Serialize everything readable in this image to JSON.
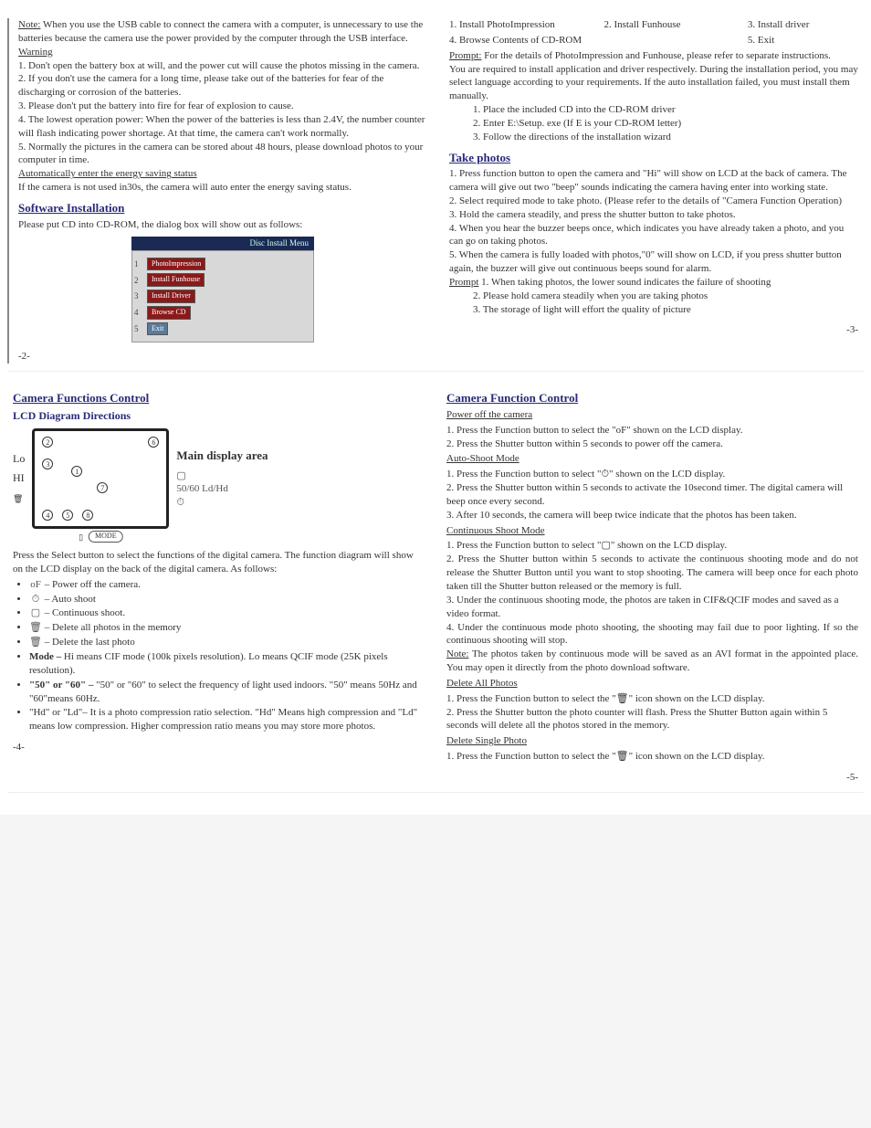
{
  "p2": {
    "note_label": "Note:",
    "note_text": "When you use the USB cable to connect the camera with a computer, is unnecessary to use the batteries because the camera use the power provided by the computer through the USB interface.",
    "warning_label": "Warning",
    "w1": "1.   Don't open the battery box at will, and the power cut will cause the photos missing in the camera.",
    "w2": "2.   If you don't use the camera for a long time, please take out of the batteries for fear of the discharging or corrosion of the batteries.",
    "w3": "3.   Please don't put the battery into fire for fear of explosion to cause.",
    "w4": "4.   The lowest operation power: When the power of the batteries is less than 2.4V, the number counter will flash indicating power shortage. At that time, the camera can't work normally.",
    "w5": "5.   Normally the pictures in the camera can be stored about 48 hours, please download photos to your computer in time.",
    "auto_label": "Automatically enter the energy saving status",
    "auto_text": "If the camera is not used in30s, the camera will auto enter the energy saving status.",
    "soft_heading": "Software Installation",
    "soft_text": "Please put CD into CD-ROM, the dialog box will show out as follows:",
    "dialog_title": "Disc Install Menu",
    "pagenum": "-2-"
  },
  "p3": {
    "opt1": "1. Install PhotoImpression",
    "opt2": "2. Install Funhouse",
    "opt3": "3. Install driver",
    "opt4": "4. Browse Contents of CD-ROM",
    "opt5": "5. Exit",
    "prompt_label": "Prompt:",
    "prompt_text": "For the details of PhotoImpression and Funhouse, please refer to separate instructions.",
    "para": "You are required to install application and driver respectively. During the installation period, you may select language according to your requirements. If the auto installation failed, you must install them manually.",
    "m1": "1.   Place the included CD into the CD-ROM driver",
    "m2": "2.   Enter E:\\Setup. exe (If E is your CD-ROM letter)",
    "m3": "3.   Follow the directions of the installation wizard",
    "take_heading": "Take photos",
    "t1": "1.   Press function button to open the camera and \"Hi\" will show on LCD at the back of camera. The camera will give out two \"beep\" sounds indicating the camera having enter into working state.",
    "t2": "2.   Select required mode to take photo. (Please refer to the details of \"Camera Function Operation)",
    "t3": "3.   Hold the camera steadily, and press the shutter button to take photos.",
    "t4": "4.   When you hear the buzzer beeps once, which indicates you have already taken a photo, and you can go on taking photos.",
    "t5": "5.   When the camera is fully loaded with photos,\"0\" will show on LCD, if you press shutter button again, the buzzer will give out continuous beeps sound for alarm.",
    "pr_label": "Prompt",
    "pr1": "1.   When taking photos, the lower sound indicates the failure of shooting",
    "pr2": "2.   Please hold camera steadily when you are taking photos",
    "pr3": "3.   The storage of light will effort the quality of picture",
    "pagenum": "-3-"
  },
  "p4": {
    "heading": "Camera Functions Control",
    "sub": "LCD Diagram Directions",
    "main_display": "Main display area",
    "lcd_text": "50/60  Ld/Hd",
    "lo": "Lo",
    "hi": "HI",
    "mode": "MODE",
    "intro": "Press the Select button to select the functions of the digital camera. The function diagram will show on the LCD display on the back of the digital camera. As follows:",
    "b1": "– Power off the camera.",
    "b2": "– Auto shoot",
    "b3": "– Continuous shoot.",
    "b4": "– Delete all photos in the memory",
    "b5": "– Delete the last photo",
    "b6_label": "Mode –",
    "b6": "Hi means CIF mode (100k pixels resolution). Lo means QCIF mode (25K pixels resolution).",
    "b7_label": "\"50\" or \"60\" –",
    "b7": "\"50\" or \"60\" to select the frequency of light used indoors. \"50\" means 50Hz and \"60\"means 60Hz.",
    "b8": "\"Hd\" or \"Ld\"– It is a photo compression ratio selection.   \"Hd\" Means high compression and \"Ld\" means low compression. Higher compression ratio means you may store more photos.",
    "pagenum": "-4-"
  },
  "p5": {
    "heading": "Camera Function Control",
    "pw_label": "Power off the camera",
    "pw1": "1.   Press the Function button to select the \"oF\" shown on the LCD display.",
    "pw2": "2.   Press the Shutter button within 5 seconds to power off the camera.",
    "as_label": "Auto-Shoot Mode",
    "as1": "1.   Press the Function button to select \"⏱\" shown on the LCD display.",
    "as2": "2.   Press the Shutter button within 5 seconds to activate the 10second timer. The digital camera will beep once every second.",
    "as3": "3.   After 10 seconds, the camera will beep twice indicate that the photos has been taken.",
    "cs_label": "Continuous Shoot Mode",
    "cs1": "1.   Press the Function button to select \"▢\" shown on the LCD display.",
    "cs2": "2.   Press the Shutter button within 5 seconds to activate the continuous shooting mode and do not release the Shutter Button until you want to stop shooting. The camera will beep once for each photo taken till the Shutter button released or the memory is full.",
    "cs3": "3.   Under the continuous shooting mode, the photos are taken in CIF&QCIF modes and saved as a video format.",
    "cs4": "4.   Under the continuous mode photo shooting, the shooting may fail due to poor lighting. If so the continuous shooting will stop.",
    "note_label": "Note:",
    "note": "The photos taken by continuous mode will be saved as an AVI format in the appointed place. You may open it directly from the photo download software.",
    "da_label": "Delete All Photos",
    "da1": "1.   Press the Function button to select the \"🗑\" icon shown on the LCD display.",
    "da2": "2.   Press the Shutter button the photo counter will flash. Press the Shutter Button again within 5 seconds will delete all the photos stored in the memory.",
    "ds_label": "Delete Single Photo",
    "ds1": "1.   Press the Function button to select the \"🗑\" icon shown on the LCD display.",
    "pagenum": "-5-"
  }
}
